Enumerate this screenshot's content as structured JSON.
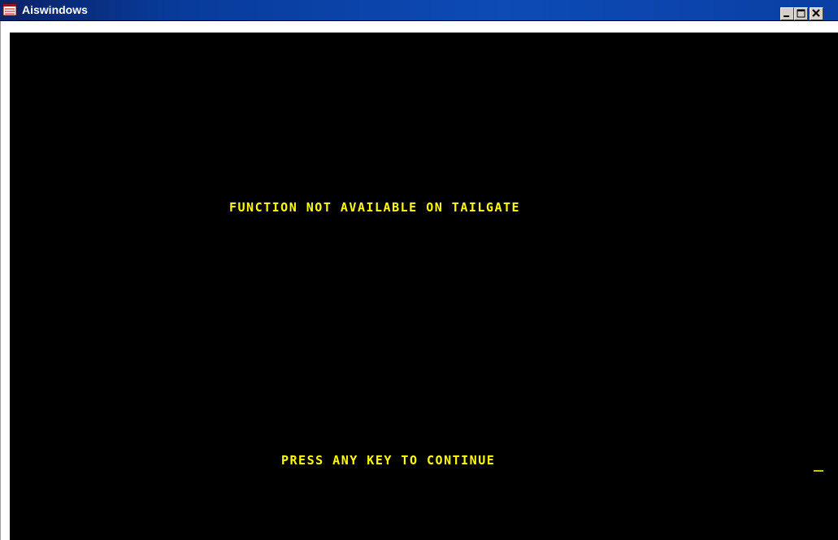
{
  "window": {
    "title": "Aiswindows",
    "icon": "app-window-icon",
    "controls": [
      "minimize-icon",
      "maximize-icon",
      "close-icon"
    ]
  },
  "console": {
    "background": "#000000",
    "text_color": "#ffff00",
    "message": "FUNCTION NOT AVAILABLE ON TAILGATE",
    "prompt": "PRESS ANY KEY TO CONTINUE"
  }
}
